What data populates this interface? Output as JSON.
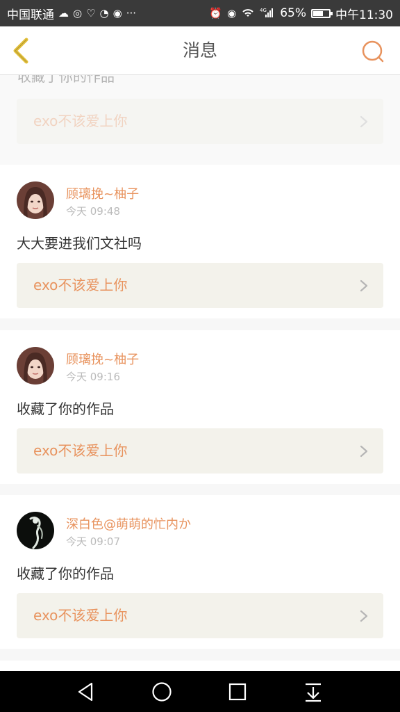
{
  "status_bar": {
    "carrier": "中国联通",
    "network": "4G",
    "battery": "65%",
    "battery_level": 0.65,
    "time": "中午11:30"
  },
  "header": {
    "title": "消息",
    "back_icon": "chevron-left-icon",
    "search_icon": "search-icon"
  },
  "colors": {
    "accent": "#e8935e",
    "title_text": "#555555",
    "time_text": "#bbbbbb",
    "link_background": "#f3f2eb",
    "status_bar": "#3a3a3a"
  },
  "faded_card": {
    "message": "收藏了你的作品",
    "work_title": "exo不该爱上你"
  },
  "messages": [
    {
      "username": "顾璃挽~柚子",
      "time": "今天 09:48",
      "message": "大大要进我们文社吗",
      "work_title": "exo不该爱上你"
    },
    {
      "username": "顾璃挽~柚子",
      "time": "今天 09:16",
      "message": "收藏了你的作品",
      "work_title": "exo不该爱上你"
    },
    {
      "username": "深白色@萌萌的忙内か",
      "time": "今天 09:07",
      "message": "收藏了你的作品",
      "work_title": "exo不该爱上你"
    }
  ],
  "nav_bar": {
    "icons": [
      "back-triangle-icon",
      "home-circle-icon",
      "recents-square-icon",
      "notification-pulldown-icon"
    ]
  }
}
